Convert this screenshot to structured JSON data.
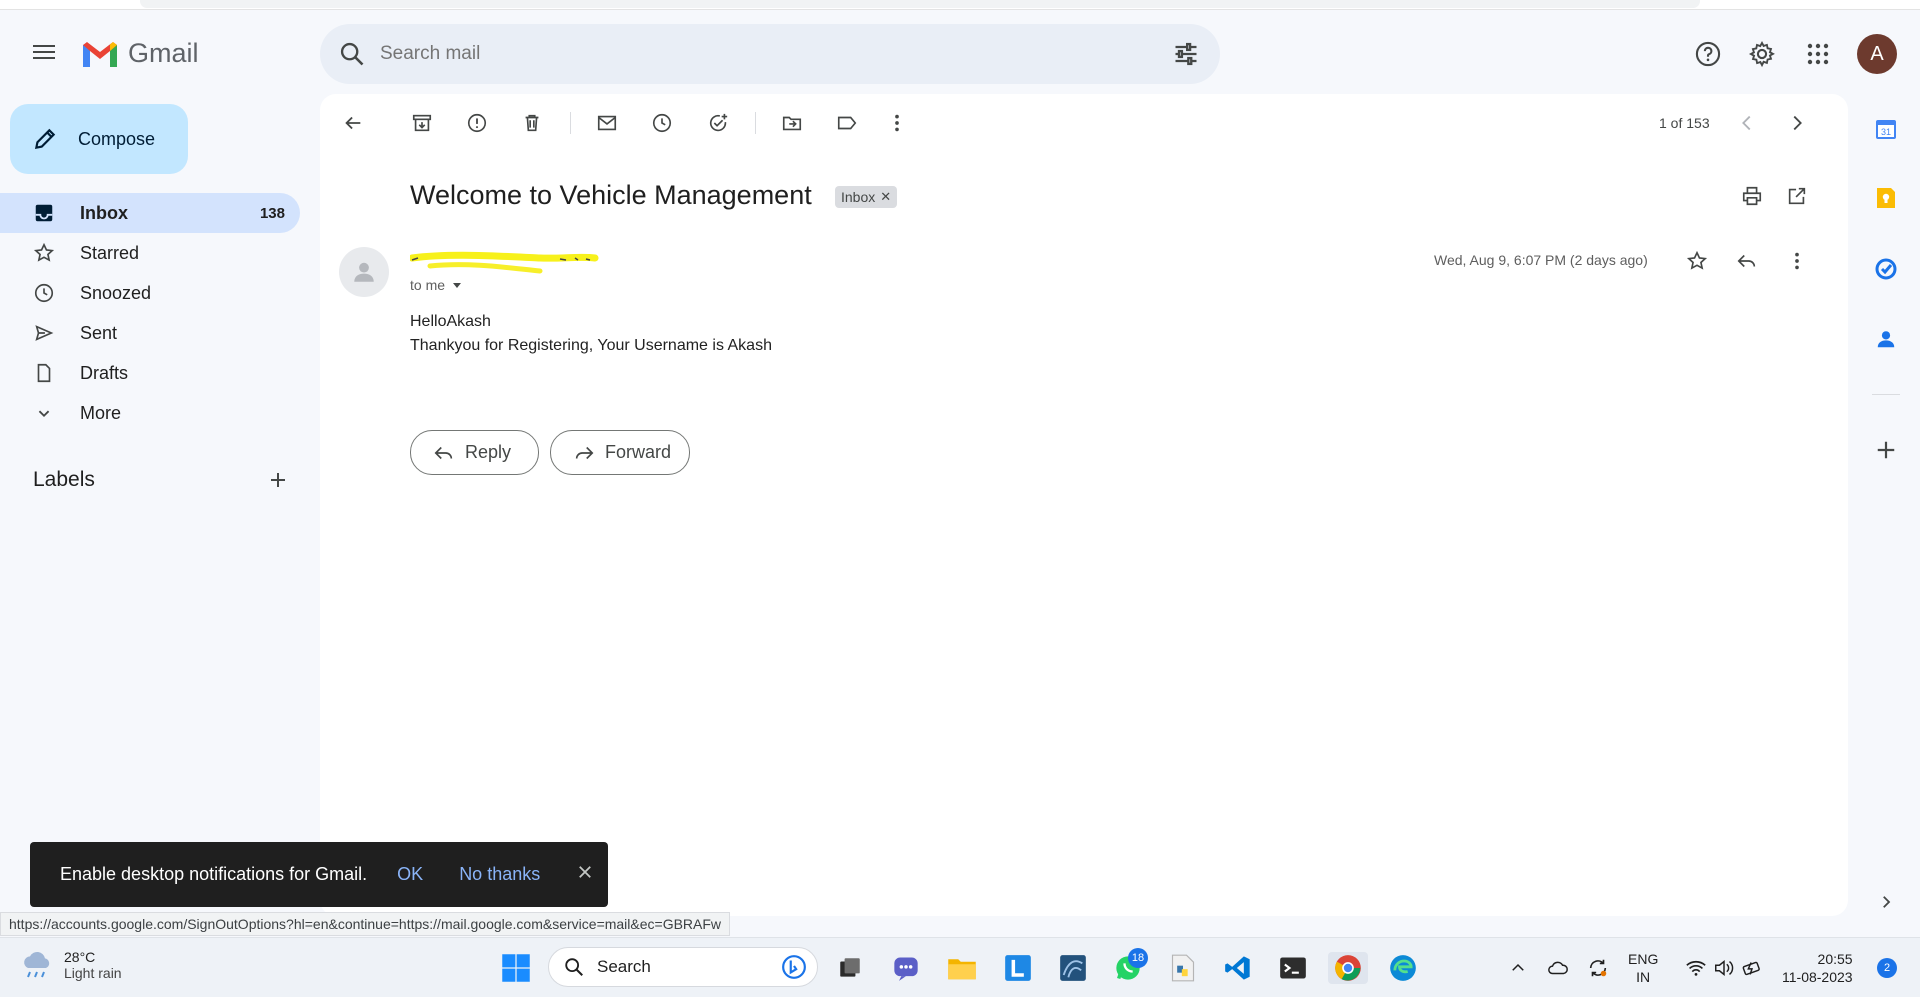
{
  "app": {
    "name": "Gmail"
  },
  "search": {
    "placeholder": "Search mail"
  },
  "header": {
    "avatar_letter": "A"
  },
  "compose": {
    "label": "Compose"
  },
  "nav": {
    "items": [
      {
        "label": "Inbox",
        "count": "138",
        "icon": "inbox-icon"
      },
      {
        "label": "Starred",
        "icon": "star-icon"
      },
      {
        "label": "Snoozed",
        "icon": "clock-icon"
      },
      {
        "label": "Sent",
        "icon": "send-icon"
      },
      {
        "label": "Drafts",
        "icon": "draft-icon"
      },
      {
        "label": "More",
        "icon": "chevron-down-icon"
      }
    ],
    "labels_title": "Labels"
  },
  "toolbar": {
    "pager": "1 of 153"
  },
  "email": {
    "subject": "Welcome to Vehicle Management",
    "label_chip": "Inbox",
    "to": "to me",
    "date": "Wed, Aug 9, 6:07 PM (2 days ago)",
    "body_line1": "HelloAkash",
    "body_line2": "Thankyou for Registering, Your Username is Akash",
    "reply_label": "Reply",
    "forward_label": "Forward"
  },
  "snackbar": {
    "message": "Enable desktop notifications for Gmail.",
    "ok": "OK",
    "no_thanks": "No thanks"
  },
  "status_url": "https://accounts.google.com/SignOutOptions?hl=en&continue=https://mail.google.com&service=mail&ec=GBRAFw",
  "taskbar": {
    "weather_temp": "28°C",
    "weather_desc": "Light rain",
    "search_label": "Search",
    "whatsapp_badge": "18",
    "lang_top": "ENG",
    "lang_bottom": "IN",
    "time": "20:55",
    "date": "11-08-2023",
    "notif_count": "2"
  },
  "colors": {
    "accent": "#0b57d0",
    "selected_nav": "#d3e3fd",
    "compose_bg": "#c2e7ff"
  }
}
